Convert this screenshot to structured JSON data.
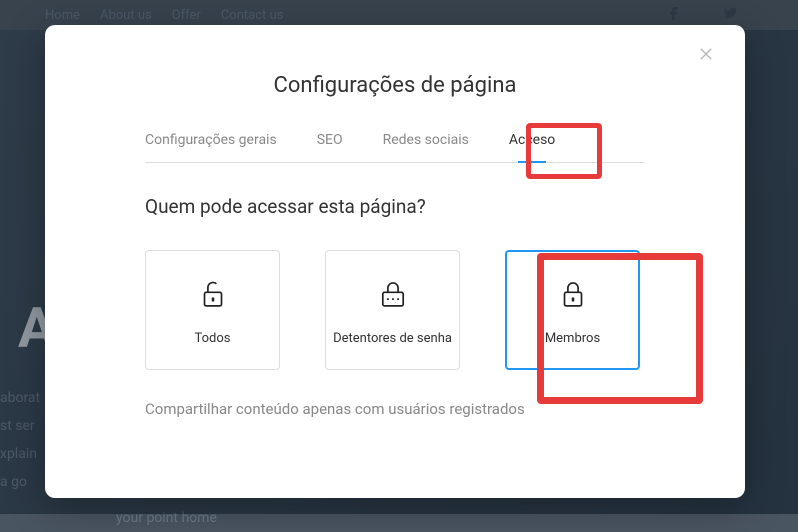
{
  "nav": {
    "home": "Home",
    "about": "About us",
    "offer": "Offer",
    "contact": "Contact us"
  },
  "bg": {
    "letter": "A",
    "text1": "aborat",
    "text2": "st ser",
    "text3": "xplain",
    "text4": "a go",
    "text5": "your point home"
  },
  "modal": {
    "title": "Configurações de página",
    "tabs": {
      "general": "Configurações gerais",
      "seo": "SEO",
      "social": "Redes sociais",
      "access": "Acceso"
    },
    "question": "Quem pode acessar esta página?",
    "options": {
      "all": "Todos",
      "password": "Detentores de senha",
      "members": "Membros"
    },
    "description": "Compartilhar conteúdo apenas com usuários registrados"
  }
}
